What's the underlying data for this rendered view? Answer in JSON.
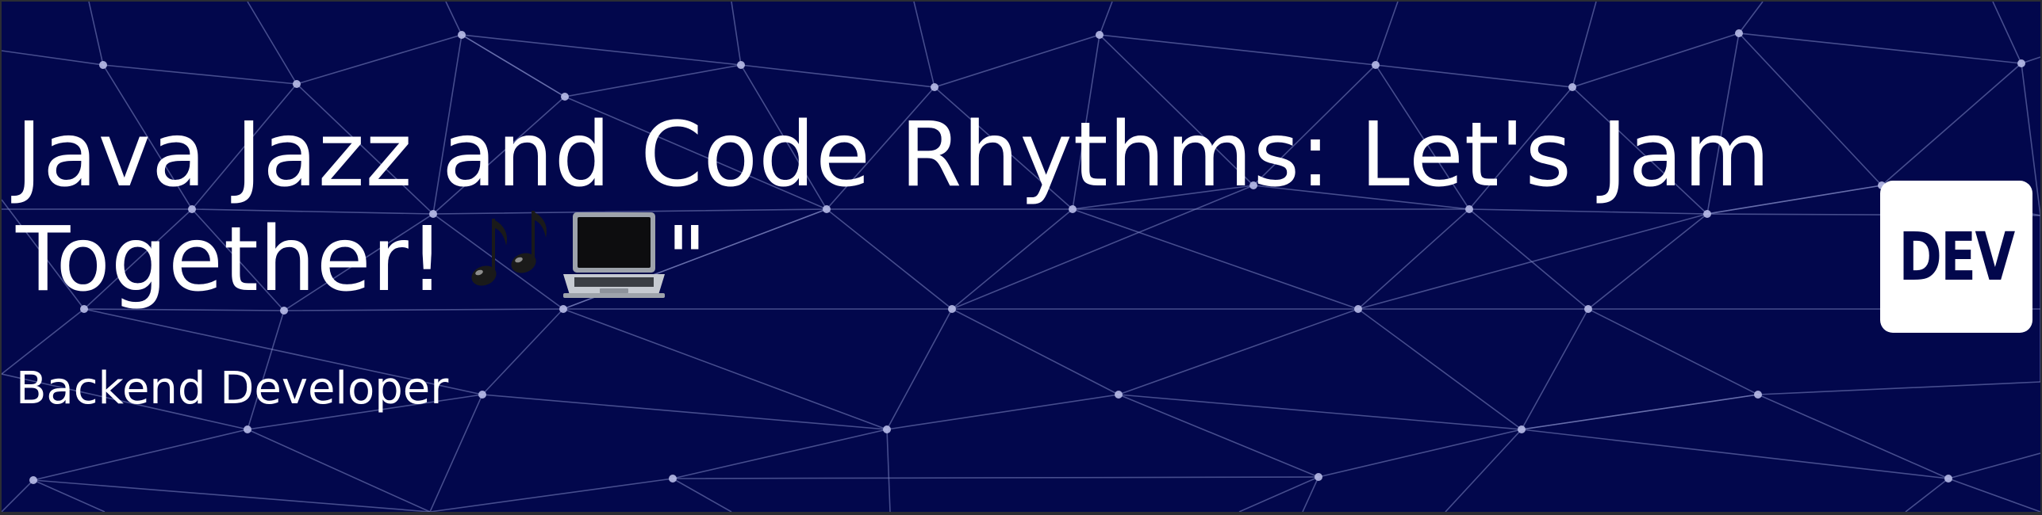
{
  "banner": {
    "title": "Java Jazz and Code Rhythms: Let's Jam Together!",
    "title_suffix": "\"",
    "emoji_icons": [
      "musical-notes-icon",
      "laptop-icon"
    ],
    "subtitle": "Backend Developer",
    "logo_text": "DEV",
    "colors": {
      "background": "#02074c",
      "text": "#ffffff",
      "network_lines": "#7f86c2"
    }
  }
}
